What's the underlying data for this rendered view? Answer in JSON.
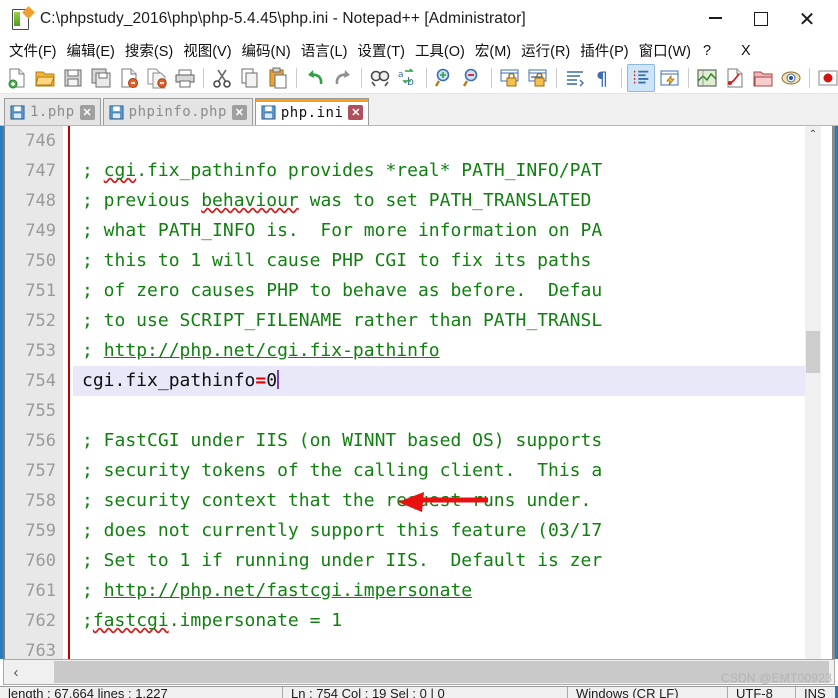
{
  "window": {
    "title": "C:\\phpstudy_2016\\php\\php-5.4.45\\php.ini - Notepad++ [Administrator]",
    "app_icon": "notepad-plus-plus-icon",
    "minimize_label": "─",
    "maximize_label": "□",
    "close_label": "✕"
  },
  "menu": {
    "items": [
      {
        "label": "文件(F)",
        "name": "menu-file"
      },
      {
        "label": "编辑(E)",
        "name": "menu-edit"
      },
      {
        "label": "搜索(S)",
        "name": "menu-search"
      },
      {
        "label": "视图(V)",
        "name": "menu-view"
      },
      {
        "label": "编码(N)",
        "name": "menu-encoding"
      },
      {
        "label": "语言(L)",
        "name": "menu-language"
      },
      {
        "label": "设置(T)",
        "name": "menu-settings"
      },
      {
        "label": "工具(O)",
        "name": "menu-tools"
      },
      {
        "label": "宏(M)",
        "name": "menu-macro"
      },
      {
        "label": "运行(R)",
        "name": "menu-run"
      },
      {
        "label": "插件(P)",
        "name": "menu-plugins"
      },
      {
        "label": "窗口(W)",
        "name": "menu-window"
      },
      {
        "label": "?",
        "name": "menu-help"
      },
      {
        "label": "X",
        "name": "menu-close-document"
      }
    ]
  },
  "toolbar": {
    "overflow_label": "»",
    "buttons": [
      {
        "name": "new-file-icon",
        "title": "New"
      },
      {
        "name": "open-file-icon",
        "title": "Open"
      },
      {
        "name": "save-icon",
        "title": "Save"
      },
      {
        "name": "save-all-icon",
        "title": "Save All"
      },
      {
        "name": "close-file-icon",
        "title": "Close"
      },
      {
        "name": "close-all-files-icon",
        "title": "Close All"
      },
      {
        "name": "print-icon",
        "title": "Print"
      },
      {
        "name": "cut-icon",
        "title": "Cut"
      },
      {
        "name": "copy-icon",
        "title": "Copy"
      },
      {
        "name": "paste-icon",
        "title": "Paste"
      },
      {
        "name": "undo-icon",
        "title": "Undo"
      },
      {
        "name": "redo-icon",
        "title": "Redo"
      },
      {
        "name": "find-icon",
        "title": "Find"
      },
      {
        "name": "replace-icon",
        "title": "Replace"
      },
      {
        "name": "zoom-in-icon",
        "title": "Zoom In"
      },
      {
        "name": "zoom-out-icon",
        "title": "Zoom Out"
      },
      {
        "name": "sync-vertical-scroll-icon",
        "title": "Synchronize Vertical Scrolling"
      },
      {
        "name": "sync-horizontal-scroll-icon",
        "title": "Synchronize Horizontal Scrolling"
      },
      {
        "name": "word-wrap-icon",
        "title": "Word Wrap"
      },
      {
        "name": "show-all-characters-icon",
        "title": "Show All Characters"
      },
      {
        "name": "indent-guide-icon",
        "title": "Show Indent Guide"
      },
      {
        "name": "user-defined-dialog-icon",
        "title": "User Defined Dialogue"
      },
      {
        "name": "document-map-icon",
        "title": "Document Map"
      },
      {
        "name": "function-list-icon",
        "title": "Function List"
      },
      {
        "name": "folder-as-workspace-icon",
        "title": "Folder as Workspace"
      },
      {
        "name": "monitoring-icon",
        "title": "Monitoring"
      },
      {
        "name": "record-macro-icon",
        "title": "Start Recording"
      }
    ]
  },
  "tabs": [
    {
      "label": "1.php",
      "active": false,
      "icon": "saved-file-icon",
      "close": "✕"
    },
    {
      "label": "phpinfo.php",
      "active": false,
      "icon": "saved-file-icon",
      "close": "✕"
    },
    {
      "label": "php.ini",
      "active": true,
      "icon": "saved-file-icon",
      "close": "✕"
    }
  ],
  "editor": {
    "first_line_number": 746,
    "current_line": 754,
    "lines": [
      {
        "n": "746",
        "segments": []
      },
      {
        "n": "747",
        "segments": [
          {
            "t": "; ",
            "s": "c"
          },
          {
            "t": "cgi",
            "s": "c sq"
          },
          {
            "t": ".fix_pathinfo provides *real* PATH_INFO/PAT",
            "s": "c"
          }
        ]
      },
      {
        "n": "748",
        "segments": [
          {
            "t": "; previous ",
            "s": "c"
          },
          {
            "t": "behaviour",
            "s": "c sq"
          },
          {
            "t": " was to set PATH_TRANSLATED",
            "s": "c"
          }
        ]
      },
      {
        "n": "749",
        "segments": [
          {
            "t": "; what PATH_INFO is.  For more information on PA",
            "s": "c"
          }
        ]
      },
      {
        "n": "750",
        "segments": [
          {
            "t": "; this to 1 will cause PHP CGI to fix its paths",
            "s": "c"
          }
        ]
      },
      {
        "n": "751",
        "segments": [
          {
            "t": "; of zero causes PHP to behave as before.  Defau",
            "s": "c"
          }
        ]
      },
      {
        "n": "752",
        "segments": [
          {
            "t": "; to use SCRIPT_FILENAME rather than PATH_TRANSL",
            "s": "c"
          }
        ]
      },
      {
        "n": "753",
        "segments": [
          {
            "t": "; ",
            "s": "c"
          },
          {
            "t": "http://php.net/cgi.fix-pathinfo",
            "s": "c u"
          }
        ]
      },
      {
        "n": "754",
        "current": true,
        "segments": [
          {
            "t": "cgi.fix_pathinfo",
            "s": "key"
          },
          {
            "t": "=",
            "s": "op"
          },
          {
            "t": "0",
            "s": "num"
          }
        ]
      },
      {
        "n": "755",
        "segments": []
      },
      {
        "n": "756",
        "segments": [
          {
            "t": "; FastCGI under IIS (on WINNT based OS) supports",
            "s": "c"
          }
        ]
      },
      {
        "n": "757",
        "segments": [
          {
            "t": "; security tokens of the calling client.  This a",
            "s": "c"
          }
        ]
      },
      {
        "n": "758",
        "segments": [
          {
            "t": "; security context that the request runs under. ",
            "s": "c"
          }
        ]
      },
      {
        "n": "759",
        "segments": [
          {
            "t": "; does not currently support this feature (03/17",
            "s": "c"
          }
        ]
      },
      {
        "n": "760",
        "segments": [
          {
            "t": "; Set to 1 if running under IIS.  Default is zer",
            "s": "c"
          }
        ]
      },
      {
        "n": "761",
        "segments": [
          {
            "t": "; ",
            "s": "c"
          },
          {
            "t": "http://php.net/fastcgi.impersonate",
            "s": "c u"
          }
        ]
      },
      {
        "n": "762",
        "segments": [
          {
            "t": ";",
            "s": "c"
          },
          {
            "t": "fastcgi",
            "s": "c sq"
          },
          {
            "t": ".impersonate = 1",
            "s": "c"
          }
        ]
      },
      {
        "n": "763",
        "segments": []
      }
    ],
    "annotation": {
      "name": "red-arrow-annotation",
      "points_to": "cgi.fix_pathinfo=0"
    }
  },
  "scrollbars": {
    "vertical_up_label": "⌃",
    "horizontal_left_label": "‹",
    "horizontal_right_label": "›"
  },
  "watermark": {
    "text": "CSDN @EMT00923"
  },
  "statusbar": {
    "document_info": "length : 67,664    lines : 1,227",
    "caret_info": "Ln : 754    Col : 19    Sel : 0 | 0",
    "eol": "Windows (CR LF)",
    "encoding": "UTF-8",
    "insert_mode": "INS"
  }
}
